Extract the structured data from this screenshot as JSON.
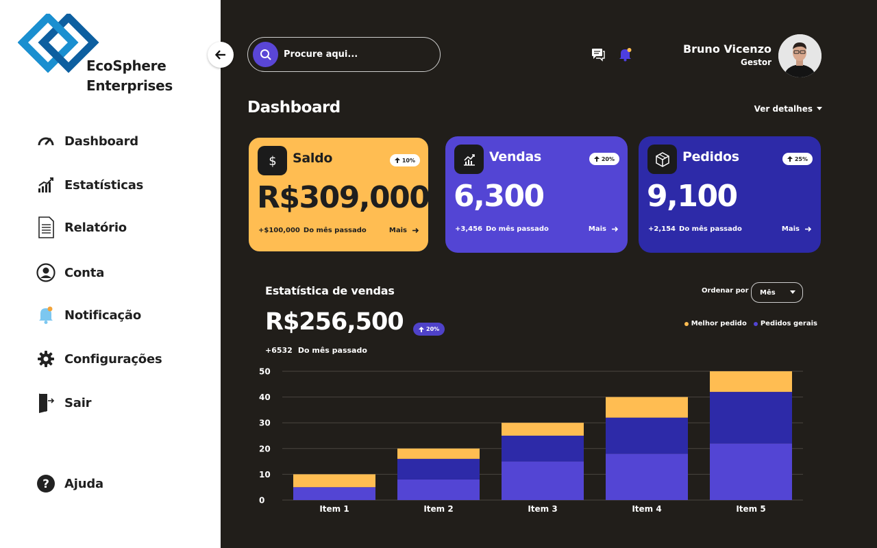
{
  "brand": {
    "name_line1": "EcoSphere",
    "name_line2": "Enterprises"
  },
  "sidebar": {
    "items": [
      {
        "label": "Dashboard",
        "icon": "gauge-icon"
      },
      {
        "label": "Estatísticas",
        "icon": "bar-growth-icon"
      },
      {
        "label": "Relatório",
        "icon": "document-icon"
      },
      {
        "label": "Conta",
        "icon": "user-circle-icon"
      },
      {
        "label": "Notificação",
        "icon": "bell-icon"
      },
      {
        "label": "Configurações",
        "icon": "gear-icon"
      },
      {
        "label": "Sair",
        "icon": "exit-door-icon"
      }
    ],
    "help": {
      "label": "Ajuda",
      "icon": "question-icon"
    }
  },
  "header": {
    "search_placeholder": "Procure aqui...",
    "user_name": "Bruno Vicenzo",
    "user_role": "Gestor"
  },
  "main": {
    "title": "Dashboard",
    "details_label": "Ver detalhes"
  },
  "cards": [
    {
      "title": "Saldo",
      "badge": "10%",
      "value": "R$309,000",
      "delta": "+$100,000",
      "delta_label": "Do mês passado",
      "more": "Mais"
    },
    {
      "title": "Vendas",
      "badge": "20%",
      "value": "6,300",
      "delta": "+3,456",
      "delta_label": "Do mês passado",
      "more": "Mais"
    },
    {
      "title": "Pedidos",
      "badge": "25%",
      "value": "9,100",
      "delta": "+2,154",
      "delta_label": "Do mês passado",
      "more": "Mais"
    }
  ],
  "stats": {
    "title": "Estatística de vendas",
    "value": "R$256,500",
    "badge": "20%",
    "delta": "+6532",
    "delta_label": "Do mês passado",
    "order_label": "Ordenar por",
    "order_value": "Mês",
    "legend": [
      {
        "name": "Melhor pedido",
        "color": "#ffbd52"
      },
      {
        "name": "Pedidos gerais",
        "color": "#5345d4"
      }
    ]
  },
  "colors": {
    "accent": "#5a46d6",
    "yellow": "#ffbd52",
    "purple": "#5345d4",
    "dark_blue": "#2d2aa8",
    "background": "#211e1a"
  },
  "chart_data": {
    "type": "bar",
    "stacked": true,
    "categories": [
      "Item 1",
      "Item 2",
      "Item 3",
      "Item 4",
      "Item 5"
    ],
    "series": [
      {
        "name": "Pedidos gerais",
        "values": [
          5,
          8,
          15,
          18,
          22
        ],
        "color": "#5345d4"
      },
      {
        "values": [
          0,
          8,
          10,
          14,
          20
        ],
        "color": "#2d2aa8"
      },
      {
        "name": "Melhor pedido",
        "values": [
          5,
          4,
          5,
          8,
          8
        ],
        "color": "#ffbd52"
      }
    ],
    "ylim": [
      0,
      50
    ],
    "yticks": [
      0,
      10,
      20,
      30,
      40,
      50
    ],
    "grid": true,
    "legend": "top-right"
  }
}
